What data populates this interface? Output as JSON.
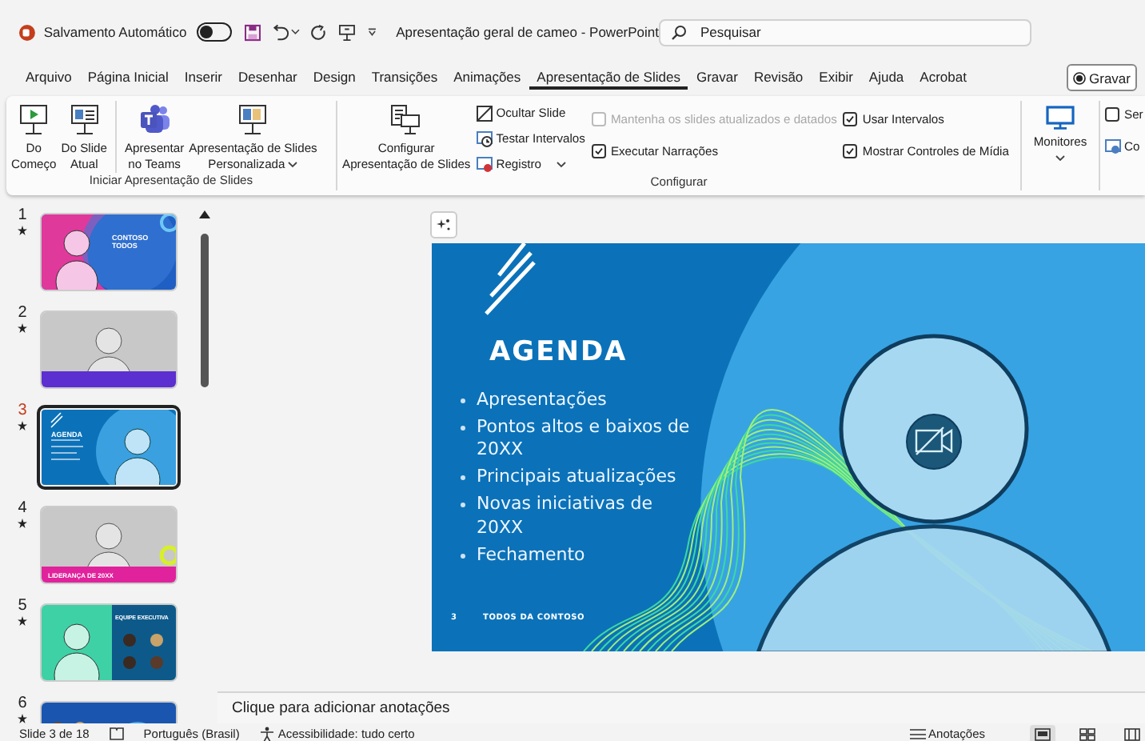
{
  "title_bar": {
    "autosave_label": "Salvamento Automático",
    "autosave_on": false,
    "document_title": "Apresentação geral de cameo  -  PowerPoint",
    "search": {
      "placeholder": "Pesquisar"
    }
  },
  "tabs": [
    {
      "label": "Arquivo",
      "selected": false
    },
    {
      "label": "Página Inicial",
      "selected": false
    },
    {
      "label": "Inserir",
      "selected": false
    },
    {
      "label": "Desenhar",
      "selected": false
    },
    {
      "label": "Design",
      "selected": false
    },
    {
      "label": "Transições",
      "selected": false
    },
    {
      "label": "Animações",
      "selected": false
    },
    {
      "label": "Apresentação de Slides",
      "selected": true
    },
    {
      "label": "Gravar",
      "selected": false
    },
    {
      "label": "Revisão",
      "selected": false
    },
    {
      "label": "Exibir",
      "selected": false
    },
    {
      "label": "Ajuda",
      "selected": false
    },
    {
      "label": "Acrobat",
      "selected": false
    }
  ],
  "record_button": {
    "label": "Gravar"
  },
  "ribbon": {
    "start_group": {
      "label": "Iniciar Apresentação de Slides",
      "buttons": [
        {
          "kind": "from-start",
          "lines": [
            "Do",
            "Começo"
          ]
        },
        {
          "kind": "from-current",
          "lines": [
            "Do Slide",
            "Atual"
          ]
        },
        {
          "kind": "teams",
          "lines": [
            "Apresentar",
            "no Teams"
          ]
        },
        {
          "kind": "custom",
          "lines": [
            "Apresentação de Slides",
            "Personalizada"
          ],
          "dropdown": true
        }
      ]
    },
    "setup_group": {
      "label": "Configurar",
      "setup_button": {
        "lines": [
          "Configurar",
          "Apresentação de Slides"
        ]
      },
      "small_buttons": [
        {
          "kind": "hide",
          "label": "Ocultar Slide",
          "dropdown": false
        },
        {
          "kind": "timings",
          "label": "Testar Intervalos",
          "dropdown": false
        },
        {
          "kind": "record",
          "label": "Registro",
          "dropdown": true
        }
      ],
      "checkboxes": [
        {
          "label": "Mantenha os slides atualizados e datados",
          "checked": false,
          "disabled": true
        },
        {
          "label": "Executar Narrações",
          "checked": true,
          "disabled": false
        },
        {
          "label": "Usar Intervalos",
          "checked": true,
          "disabled": false
        },
        {
          "label": "Mostrar Controles de Mídia",
          "checked": true,
          "disabled": false
        }
      ]
    },
    "monitors_button": {
      "label": "Monitores"
    },
    "cut_group": {
      "checkbox": {
        "label": "Ser",
        "checked": false
      },
      "button": {
        "label": "Co"
      }
    }
  },
  "thumbnails": [
    {
      "number": "1",
      "kind": "cover",
      "title": "CONTOSO TODOS",
      "selected": false
    },
    {
      "number": "2",
      "kind": "photo",
      "selected": false
    },
    {
      "number": "3",
      "kind": "agenda",
      "title": "AGENDA",
      "selected": true
    },
    {
      "number": "4",
      "kind": "leader",
      "title": "LIDERANÇA DE 20XX",
      "selected": false
    },
    {
      "number": "5",
      "kind": "team",
      "title": "EQUIPE EXECUTIVA",
      "selected": false
    },
    {
      "number": "6",
      "kind": "welcome",
      "selected": false
    }
  ],
  "slide": {
    "heading": "AGENDA",
    "bullets": [
      "Apresentações",
      "Pontos altos e baixos de 20XX",
      "Principais atualizações",
      "Novas iniciativas de 20XX",
      "Fechamento"
    ],
    "footer_number": "3",
    "footer_text": "TODOS DA CONTOSO"
  },
  "notes": {
    "placeholder": "Clique para adicionar anotações"
  },
  "status_bar": {
    "slide_position": "Slide 3 de 18",
    "language": "Português (Brasil)",
    "accessibility": "Acessibilidade: tudo certo",
    "notes_button": "Anotações"
  }
}
